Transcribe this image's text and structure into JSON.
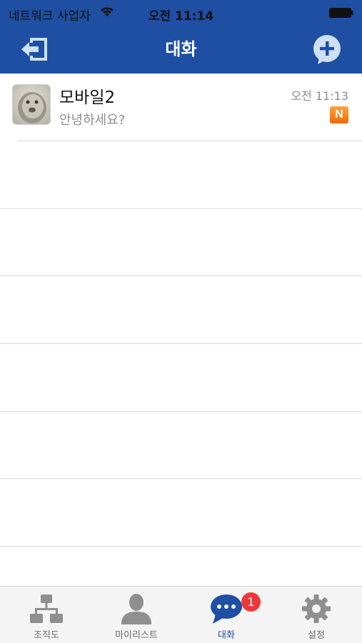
{
  "status_bar": {
    "carrier": "네트워크 사업자",
    "time": "오전 11:14"
  },
  "nav": {
    "title": "대화",
    "left_icon": "logout-icon",
    "right_icon": "add-chat-icon"
  },
  "chats": [
    {
      "name": "모바일2",
      "preview": "안녕하세요?",
      "time": "오전 11:13",
      "badge": "N"
    }
  ],
  "tabs": [
    {
      "label": "조직도",
      "icon": "org-chart-icon"
    },
    {
      "label": "마이리스트",
      "icon": "person-icon"
    },
    {
      "label": "대화",
      "icon": "chat-bubble-icon",
      "active": true,
      "badge": "1"
    },
    {
      "label": "설정",
      "icon": "gear-icon"
    }
  ],
  "colors": {
    "primary": "#1e4fa3",
    "badge_red": "#f0383c",
    "new_badge": "#ee6a00"
  }
}
